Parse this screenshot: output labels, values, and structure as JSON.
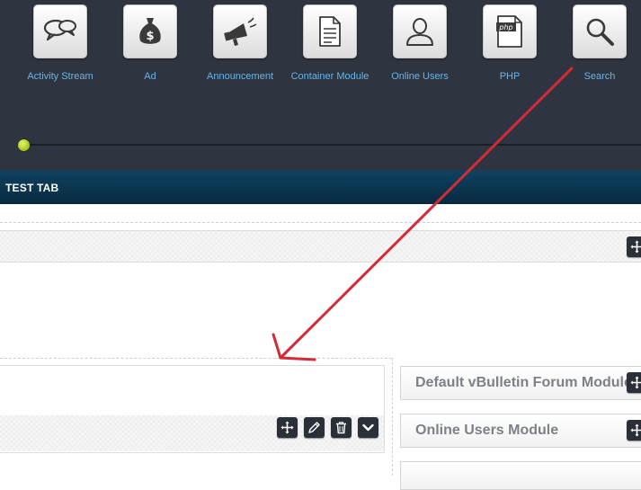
{
  "toolbar": {
    "items": [
      {
        "label": "Activity Stream",
        "icon": "speech-bubbles-icon"
      },
      {
        "label": "Ad",
        "icon": "money-bag-icon"
      },
      {
        "label": "Announcement",
        "icon": "megaphone-icon"
      },
      {
        "label": "Container Module",
        "icon": "document-icon"
      },
      {
        "label": "Online Users",
        "icon": "user-icon"
      },
      {
        "label": "PHP",
        "icon": "php-file-icon"
      },
      {
        "label": "Search",
        "icon": "magnifier-icon"
      }
    ],
    "php_badge": "php",
    "money_symbol": "$"
  },
  "tab": {
    "title": "TEST TAB"
  },
  "side_modules": [
    {
      "title": "Default vBulletin Forum Module"
    },
    {
      "title": "Online Users Module"
    }
  ],
  "colors": {
    "toolbar_bg": "#2f3540",
    "label_blue": "#69b3e6",
    "tab_bg": "#0f4261",
    "annotation_red": "#d42a35",
    "slider_knob": "#b5d43a"
  }
}
